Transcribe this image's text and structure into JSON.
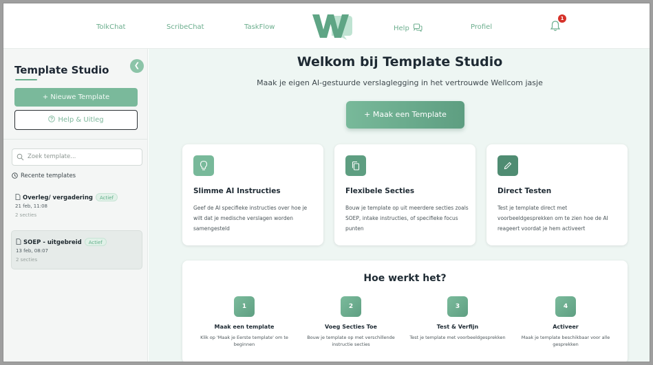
{
  "nav": {
    "items": [
      "TolkChat",
      "ScribeChat",
      "TaskFlow"
    ],
    "help_label": "Help",
    "profile_label": "Profiel",
    "notification_count": "1",
    "logo_icon": "wellcom-w-logo"
  },
  "sidebar": {
    "title": "Template Studio",
    "collapse_icon": "chevron-left-icon",
    "new_template_label": "+ Nieuwe Template",
    "help_label": "Help & Uitleg",
    "search_placeholder": "Zoek template...",
    "recent_heading": "Recente templates",
    "templates": [
      {
        "name": "Overleg/ vergadering",
        "status": "Actief",
        "date": "21 feb, 11:08",
        "sections": "2 secties",
        "selected": false
      },
      {
        "name": "SOEP - uitgebreid",
        "status": "Actief",
        "date": "13 feb, 08:07",
        "sections": "2 secties",
        "selected": true
      }
    ]
  },
  "main": {
    "title": "Welkom bij Template Studio",
    "subtitle": "Maak je eigen AI-gestuurde verslaglegging in het vertrouwde Wellcom jasje",
    "cta_label": "+ Maak een Template",
    "features": [
      {
        "icon": "lightbulb-icon",
        "title": "Slimme AI Instructies",
        "desc": "Geef de AI specifieke instructies over hoe je wilt dat je medische verslagen worden samengesteld",
        "color": "#78b99a"
      },
      {
        "icon": "copy-icon",
        "title": "Flexibele Secties",
        "desc": "Bouw je template op uit meerdere secties zoals SOEP, intake instructies, of specifieke focus punten",
        "color": "#5e9e81"
      },
      {
        "icon": "pencil-icon",
        "title": "Direct Testen",
        "desc": "Test je template direct met voorbeeldgesprekken om te zien hoe de AI reageert voordat je hem activeert",
        "color": "#4f8c72"
      }
    ],
    "how": {
      "title": "Hoe werkt het?",
      "steps": [
        {
          "num": "1",
          "title": "Maak een template",
          "desc": "Klik op 'Maak je Eerste template' om te beginnen"
        },
        {
          "num": "2",
          "title": "Voeg Secties Toe",
          "desc": "Bouw je template op met verschillende instructie secties"
        },
        {
          "num": "3",
          "title": "Test & Verfijn",
          "desc": "Test je template met voorbeeldgesprekken"
        },
        {
          "num": "4",
          "title": "Activeer",
          "desc": "Maak je template beschikbaar voor alle gesprekken"
        }
      ]
    }
  },
  "colors": {
    "accent": "#6aae8d",
    "accent_dark": "#5e9e81",
    "main_bg": "#eef6f3",
    "badge_red": "#d6322a"
  }
}
